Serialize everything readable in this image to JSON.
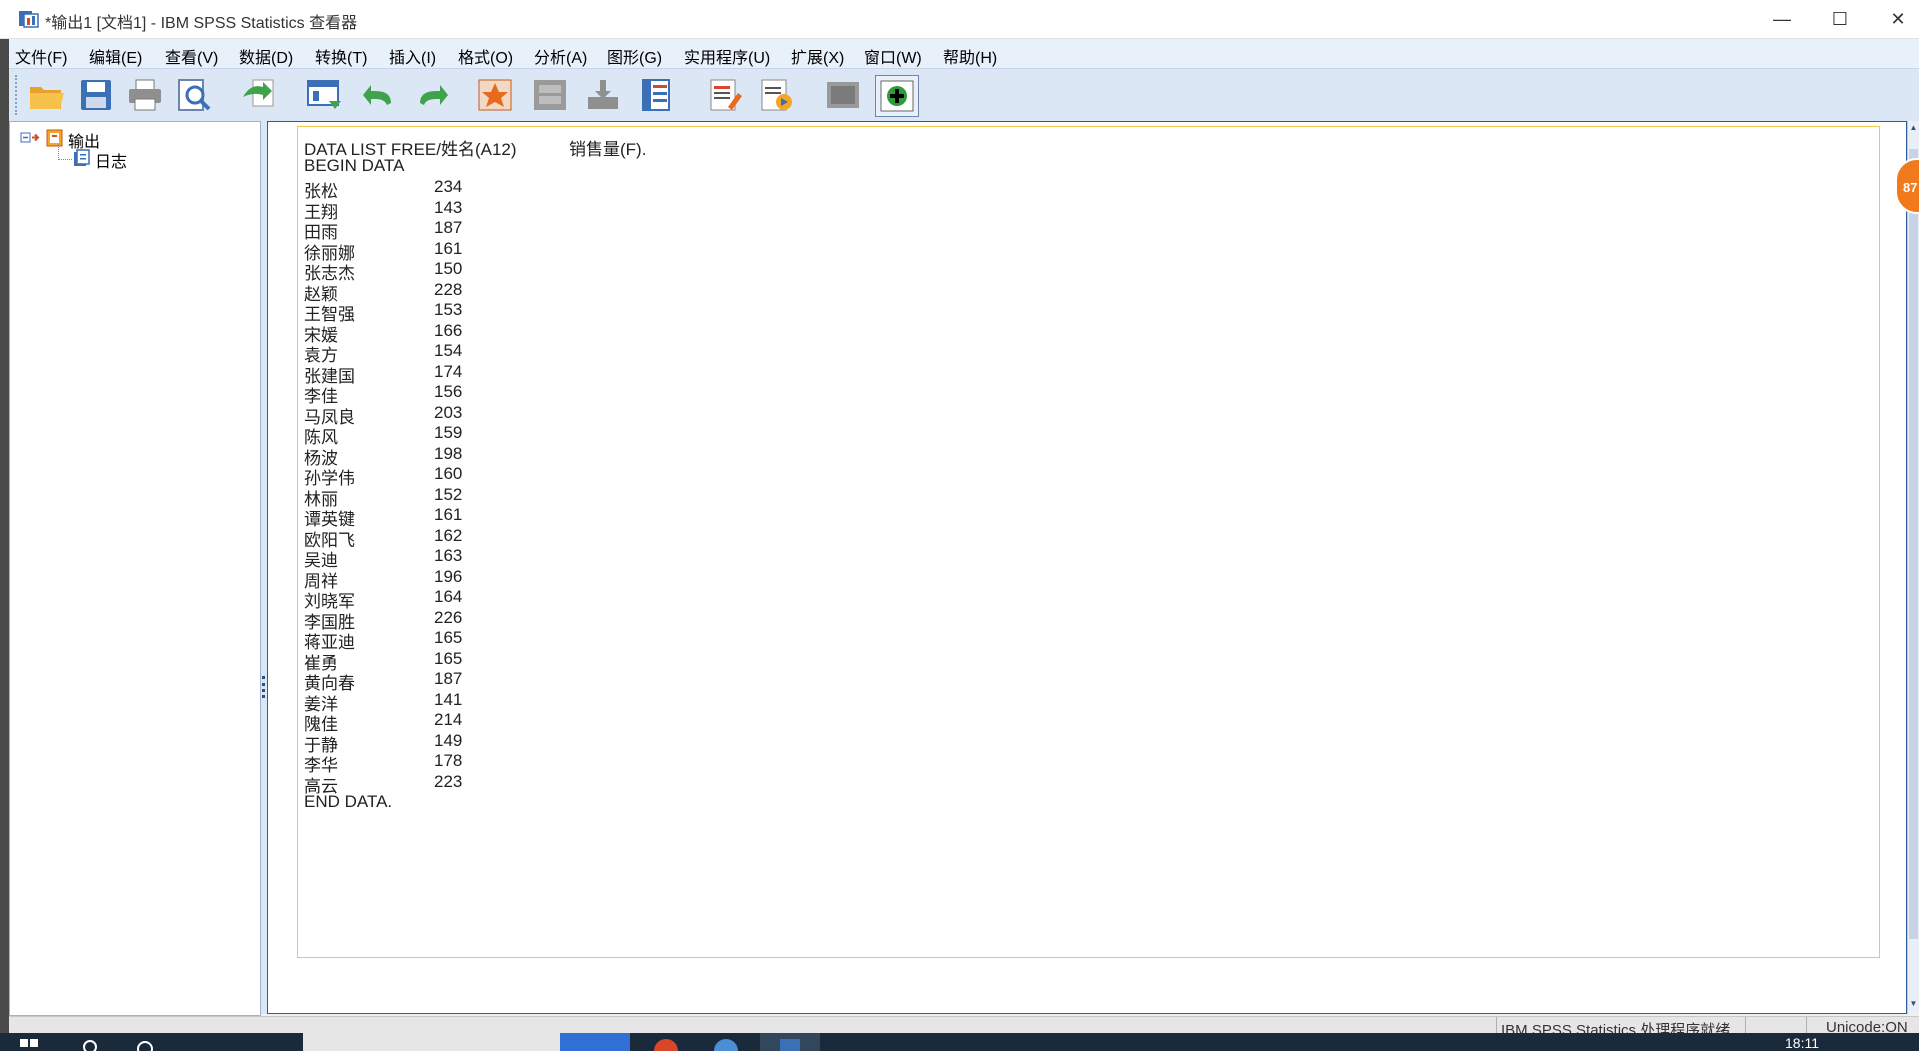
{
  "window": {
    "title": "*输出1 [文档1] - IBM SPSS Statistics 查看器",
    "minimize": "—",
    "maximize": "☐",
    "close": "✕"
  },
  "menu": [
    "文件(F)",
    "编辑(E)",
    "查看(V)",
    "数据(D)",
    "转换(T)",
    "插入(I)",
    "格式(O)",
    "分析(A)",
    "图形(G)",
    "实用程序(U)",
    "扩展(X)",
    "窗口(W)",
    "帮助(H)"
  ],
  "toolbar": [
    {
      "name": "open-icon",
      "color": "#f5a623"
    },
    {
      "name": "save-icon",
      "color": "#3b6fb6"
    },
    {
      "name": "print-icon",
      "color": "#7a7a7a"
    },
    {
      "name": "print-preview-icon",
      "color": "#5a7fb0"
    },
    {
      "name": "export-icon",
      "color": "#3fa34d"
    },
    {
      "name": "recall-dialog-icon",
      "color": "#3b6fb6"
    },
    {
      "name": "undo-icon",
      "color": "#3fa34d"
    },
    {
      "name": "redo-icon",
      "color": "#3fa34d"
    },
    {
      "name": "goto-data-icon",
      "color": "#e86a1c"
    },
    {
      "name": "goto-case-icon",
      "color": "#8a8a8a"
    },
    {
      "name": "goto-variable-icon",
      "color": "#8a8a8a"
    },
    {
      "name": "variables-icon",
      "color": "#3b6fb6"
    },
    {
      "name": "create-title-icon",
      "color": "#d9472b"
    },
    {
      "name": "create-text-icon",
      "color": "#e86a1c"
    },
    {
      "name": "show-hide-icon",
      "color": "#8a8a8a"
    },
    {
      "name": "designate-window-icon",
      "color": "#2e9b3a"
    }
  ],
  "outline": {
    "root": "输出",
    "child": "日志"
  },
  "log": {
    "header_cmd": "DATA LIST FREE/姓名(A12)",
    "header_var": "销售量(F).",
    "begin": "BEGIN DATA",
    "end": "END DATA.",
    "rows": [
      {
        "name": "张松",
        "value": "234"
      },
      {
        "name": "王翔",
        "value": "143"
      },
      {
        "name": "田雨",
        "value": "187"
      },
      {
        "name": "徐丽娜",
        "value": "161"
      },
      {
        "name": "张志杰",
        "value": "150"
      },
      {
        "name": "赵颖",
        "value": "228"
      },
      {
        "name": "王智强",
        "value": "153"
      },
      {
        "name": "宋媛",
        "value": "166"
      },
      {
        "name": "袁方",
        "value": "154"
      },
      {
        "name": "张建国",
        "value": "174"
      },
      {
        "name": "李佳",
        "value": "156"
      },
      {
        "name": "马凤良",
        "value": "203"
      },
      {
        "name": "陈风",
        "value": "159"
      },
      {
        "name": "杨波",
        "value": "198"
      },
      {
        "name": "孙学伟",
        "value": "160"
      },
      {
        "name": "林丽",
        "value": "152"
      },
      {
        "name": "谭英键",
        "value": "161"
      },
      {
        "name": "欧阳飞",
        "value": "162"
      },
      {
        "name": "吴迪",
        "value": "163"
      },
      {
        "name": "周祥",
        "value": "196"
      },
      {
        "name": "刘晓军",
        "value": "164"
      },
      {
        "name": "李国胜",
        "value": "226"
      },
      {
        "name": "蒋亚迪",
        "value": "165"
      },
      {
        "name": "崔勇",
        "value": "165"
      },
      {
        "name": "黄向春",
        "value": "187"
      },
      {
        "name": "姜洋",
        "value": "141"
      },
      {
        "name": "隗佳",
        "value": "214"
      },
      {
        "name": "于静",
        "value": "149"
      },
      {
        "name": "李华",
        "value": "178"
      },
      {
        "name": "高云",
        "value": "223"
      }
    ]
  },
  "badge": "87",
  "status": {
    "processor": "IBM SPSS Statistics 处理程序就绪",
    "unicode": "Unicode:ON"
  },
  "taskbar": {
    "clock": "18:11"
  }
}
